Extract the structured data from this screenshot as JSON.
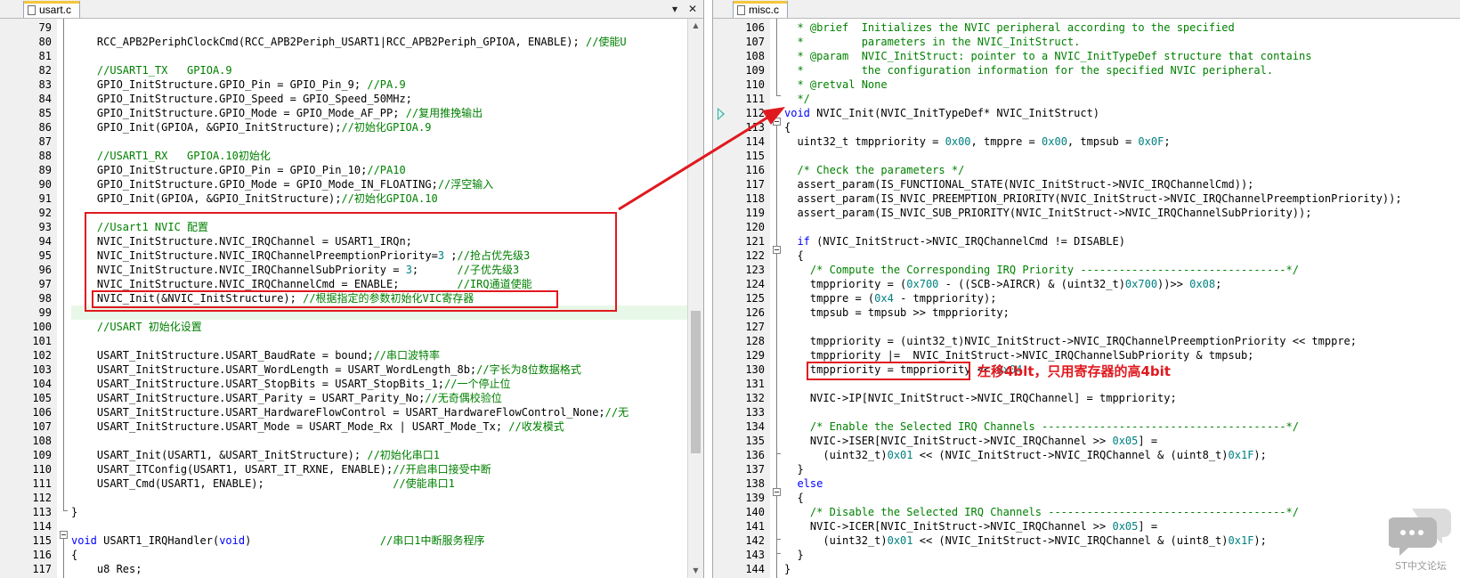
{
  "left_editor": {
    "tab": {
      "label": "usart.c",
      "icon": "document-icon"
    },
    "dropdown_icon": "chevron-down-icon",
    "close_icon": "close-icon",
    "lines": [
      {
        "n": "79",
        "t": ""
      },
      {
        "n": "80",
        "t": "    RCC_APB2PeriphClockCmd(RCC_APB2Periph_USART1|RCC_APB2Periph_GPIOA, ENABLE); //使能U"
      },
      {
        "n": "81",
        "t": ""
      },
      {
        "n": "82",
        "t": "    //USART1_TX   GPIOA.9"
      },
      {
        "n": "83",
        "t": "    GPIO_InitStructure.GPIO_Pin = GPIO_Pin_9; //PA.9"
      },
      {
        "n": "84",
        "t": "    GPIO_InitStructure.GPIO_Speed = GPIO_Speed_50MHz;"
      },
      {
        "n": "85",
        "t": "    GPIO_InitStructure.GPIO_Mode = GPIO_Mode_AF_PP; //复用推挽输出"
      },
      {
        "n": "86",
        "t": "    GPIO_Init(GPIOA, &GPIO_InitStructure);//初始化GPIOA.9"
      },
      {
        "n": "87",
        "t": ""
      },
      {
        "n": "88",
        "t": "    //USART1_RX   GPIOA.10初始化"
      },
      {
        "n": "89",
        "t": "    GPIO_InitStructure.GPIO_Pin = GPIO_Pin_10;//PA10"
      },
      {
        "n": "90",
        "t": "    GPIO_InitStructure.GPIO_Mode = GPIO_Mode_IN_FLOATING;//浮空输入"
      },
      {
        "n": "91",
        "t": "    GPIO_Init(GPIOA, &GPIO_InitStructure);//初始化GPIOA.10"
      },
      {
        "n": "92",
        "t": ""
      },
      {
        "n": "93",
        "t": "    //Usart1 NVIC 配置"
      },
      {
        "n": "94",
        "t": "    NVIC_InitStructure.NVIC_IRQChannel = USART1_IRQn;"
      },
      {
        "n": "95",
        "t": "    NVIC_InitStructure.NVIC_IRQChannelPreemptionPriority=3 ;//抢占优先级3"
      },
      {
        "n": "96",
        "t": "    NVIC_InitStructure.NVIC_IRQChannelSubPriority = 3;      //子优先级3"
      },
      {
        "n": "97",
        "t": "    NVIC_InitStructure.NVIC_IRQChannelCmd = ENABLE;         //IRQ通道使能"
      },
      {
        "n": "98",
        "t": "    NVIC_Init(&NVIC_InitStructure); //根据指定的参数初始化VIC寄存器"
      },
      {
        "n": "99",
        "t": ""
      },
      {
        "n": "100",
        "t": "    //USART 初始化设置"
      },
      {
        "n": "101",
        "t": ""
      },
      {
        "n": "102",
        "t": "    USART_InitStructure.USART_BaudRate = bound;//串口波特率"
      },
      {
        "n": "103",
        "t": "    USART_InitStructure.USART_WordLength = USART_WordLength_8b;//字长为8位数据格式"
      },
      {
        "n": "104",
        "t": "    USART_InitStructure.USART_StopBits = USART_StopBits_1;//一个停止位"
      },
      {
        "n": "105",
        "t": "    USART_InitStructure.USART_Parity = USART_Parity_No;//无奇偶校验位"
      },
      {
        "n": "106",
        "t": "    USART_InitStructure.USART_HardwareFlowControl = USART_HardwareFlowControl_None;//无"
      },
      {
        "n": "107",
        "t": "    USART_InitStructure.USART_Mode = USART_Mode_Rx | USART_Mode_Tx; //收发模式"
      },
      {
        "n": "108",
        "t": ""
      },
      {
        "n": "109",
        "t": "    USART_Init(USART1, &USART_InitStructure); //初始化串口1"
      },
      {
        "n": "110",
        "t": "    USART_ITConfig(USART1, USART_IT_RXNE, ENABLE);//开启串口接受中断"
      },
      {
        "n": "111",
        "t": "    USART_Cmd(USART1, ENABLE);                    //使能串口1"
      },
      {
        "n": "112",
        "t": ""
      },
      {
        "n": "113",
        "t": "}"
      },
      {
        "n": "114",
        "t": ""
      },
      {
        "n": "115",
        "t": "void USART1_IRQHandler(void)                    //串口1中断服务程序"
      },
      {
        "n": "116",
        "t": "{"
      },
      {
        "n": "117",
        "t": "    u8 Res;"
      }
    ]
  },
  "right_editor": {
    "tab": {
      "label": "misc.c",
      "icon": "document-icon"
    },
    "lines": [
      {
        "n": "106",
        "t": "  * @brief  Initializes the NVIC peripheral according to the specified"
      },
      {
        "n": "107",
        "t": "  *         parameters in the NVIC_InitStruct."
      },
      {
        "n": "108",
        "t": "  * @param  NVIC_InitStruct: pointer to a NVIC_InitTypeDef structure that contains"
      },
      {
        "n": "109",
        "t": "  *         the configuration information for the specified NVIC peripheral."
      },
      {
        "n": "110",
        "t": "  * @retval None"
      },
      {
        "n": "111",
        "t": "  */"
      },
      {
        "n": "112",
        "t": "void NVIC_Init(NVIC_InitTypeDef* NVIC_InitStruct)"
      },
      {
        "n": "113",
        "t": "{"
      },
      {
        "n": "114",
        "t": "  uint32_t tmppriority = 0x00, tmppre = 0x00, tmpsub = 0x0F;"
      },
      {
        "n": "115",
        "t": ""
      },
      {
        "n": "116",
        "t": "  /* Check the parameters */"
      },
      {
        "n": "117",
        "t": "  assert_param(IS_FUNCTIONAL_STATE(NVIC_InitStruct->NVIC_IRQChannelCmd));"
      },
      {
        "n": "118",
        "t": "  assert_param(IS_NVIC_PREEMPTION_PRIORITY(NVIC_InitStruct->NVIC_IRQChannelPreemptionPriority));"
      },
      {
        "n": "119",
        "t": "  assert_param(IS_NVIC_SUB_PRIORITY(NVIC_InitStruct->NVIC_IRQChannelSubPriority));"
      },
      {
        "n": "120",
        "t": ""
      },
      {
        "n": "121",
        "t": "  if (NVIC_InitStruct->NVIC_IRQChannelCmd != DISABLE)"
      },
      {
        "n": "122",
        "t": "  {"
      },
      {
        "n": "123",
        "t": "    /* Compute the Corresponding IRQ Priority --------------------------------*/"
      },
      {
        "n": "124",
        "t": "    tmppriority = (0x700 - ((SCB->AIRCR) & (uint32_t)0x700))>> 0x08;"
      },
      {
        "n": "125",
        "t": "    tmppre = (0x4 - tmppriority);"
      },
      {
        "n": "126",
        "t": "    tmpsub = tmpsub >> tmppriority;"
      },
      {
        "n": "127",
        "t": ""
      },
      {
        "n": "128",
        "t": "    tmppriority = (uint32_t)NVIC_InitStruct->NVIC_IRQChannelPreemptionPriority << tmppre;"
      },
      {
        "n": "129",
        "t": "    tmppriority |=  NVIC_InitStruct->NVIC_IRQChannelSubPriority & tmpsub;"
      },
      {
        "n": "130",
        "t": "    tmppriority = tmppriority << 0x04;"
      },
      {
        "n": "131",
        "t": ""
      },
      {
        "n": "132",
        "t": "    NVIC->IP[NVIC_InitStruct->NVIC_IRQChannel] = tmppriority;"
      },
      {
        "n": "133",
        "t": ""
      },
      {
        "n": "134",
        "t": "    /* Enable the Selected IRQ Channels --------------------------------------*/"
      },
      {
        "n": "135",
        "t": "    NVIC->ISER[NVIC_InitStruct->NVIC_IRQChannel >> 0x05] ="
      },
      {
        "n": "136",
        "t": "      (uint32_t)0x01 << (NVIC_InitStruct->NVIC_IRQChannel & (uint8_t)0x1F);"
      },
      {
        "n": "137",
        "t": "  }"
      },
      {
        "n": "138",
        "t": "  else"
      },
      {
        "n": "139",
        "t": "  {"
      },
      {
        "n": "140",
        "t": "    /* Disable the Selected IRQ Channels -------------------------------------*/"
      },
      {
        "n": "141",
        "t": "    NVIC->ICER[NVIC_InitStruct->NVIC_IRQChannel >> 0x05] ="
      },
      {
        "n": "142",
        "t": "      (uint32_t)0x01 << (NVIC_InitStruct->NVIC_IRQChannel & (uint8_t)0x1F);"
      },
      {
        "n": "143",
        "t": "  }"
      },
      {
        "n": "144",
        "t": "}"
      }
    ]
  },
  "annotations": {
    "shift_note": "左移4bit，只用寄存器的高4bit",
    "highlight_color": "#e0191f",
    "arrow": {
      "from": "nvic-config-block",
      "to": "nvic-init-function",
      "icon": "arrow-icon"
    }
  },
  "watermark": {
    "text": "ST中文论坛",
    "icon": "chat-bubble-icon"
  },
  "syntax_colors": {
    "keyword": "#0000ff",
    "comment": "#008000",
    "number": "#008080"
  }
}
